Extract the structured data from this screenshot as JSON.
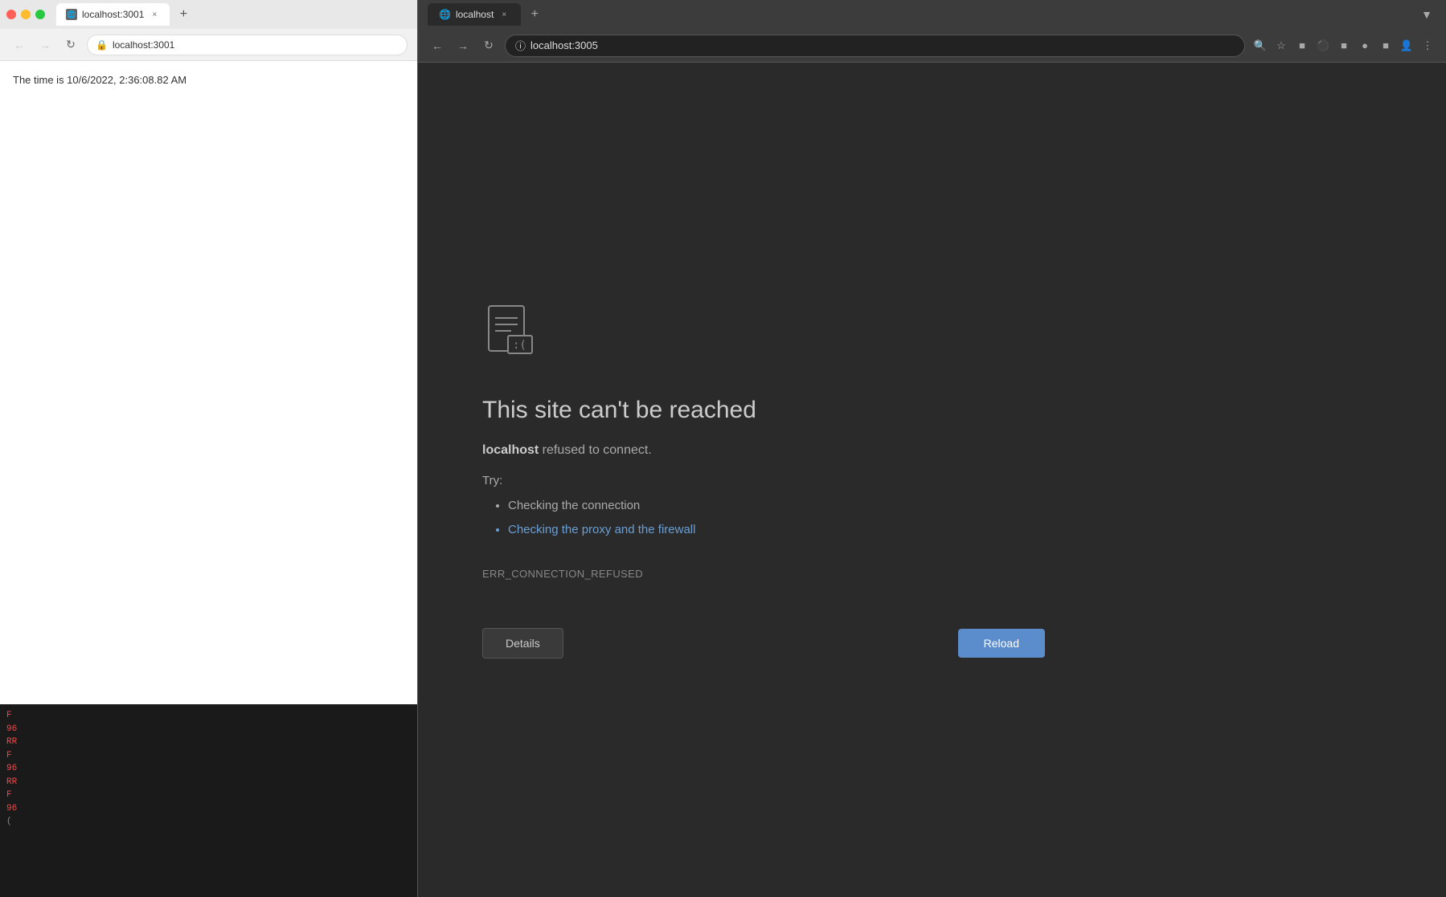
{
  "left_browser": {
    "tab": {
      "label": "localhost:3001",
      "close": "×",
      "new": "+"
    },
    "addressbar": {
      "url": "localhost:3001"
    },
    "content": {
      "page_text": "The time is 10/6/2022, 2:36:08.82 AM"
    },
    "code_lines": [
      {
        "text": "F",
        "style": "red"
      },
      {
        "text": "96",
        "style": "red"
      },
      {
        "text": "RR",
        "style": "red"
      },
      {
        "text": "F",
        "style": "red"
      },
      {
        "text": "96",
        "style": "red"
      },
      {
        "text": "RR",
        "style": "red"
      },
      {
        "text": "F",
        "style": "red"
      },
      {
        "text": "96",
        "style": "red"
      },
      {
        "text": "(",
        "style": "gray"
      }
    ]
  },
  "right_browser": {
    "tab": {
      "label": "localhost",
      "close": "×",
      "new": "+"
    },
    "addressbar": {
      "url": "localhost:3005"
    },
    "error_page": {
      "title": "This site can't be reached",
      "subtitle_bold": "localhost",
      "subtitle_rest": " refused to connect.",
      "try_label": "Try:",
      "list_items": [
        {
          "text": "Checking the connection",
          "is_link": false
        },
        {
          "text": "Checking the proxy and the firewall",
          "is_link": true
        }
      ],
      "error_code": "ERR_CONNECTION_REFUSED",
      "btn_details": "Details",
      "btn_reload": "Reload"
    }
  }
}
